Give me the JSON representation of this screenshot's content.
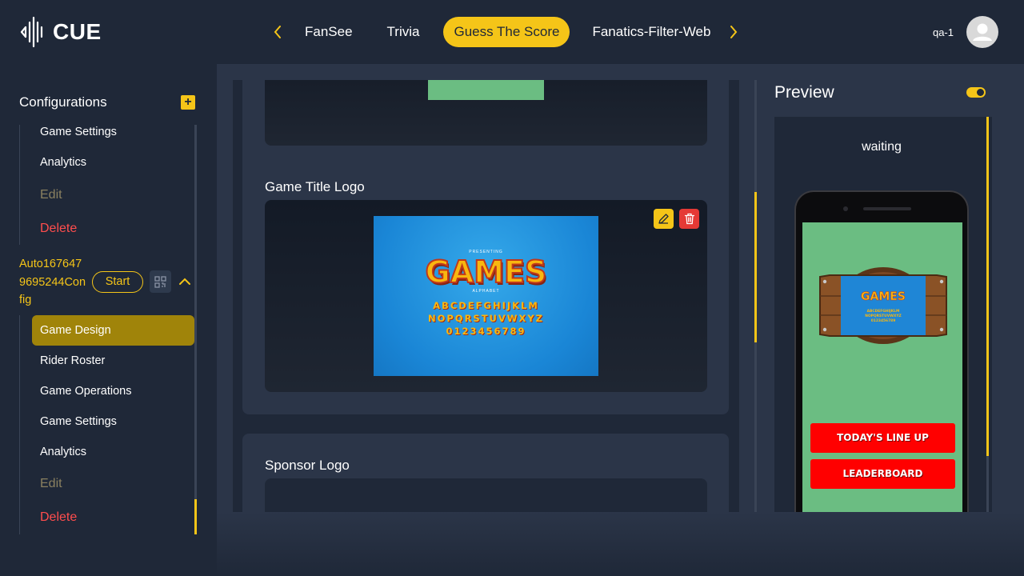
{
  "brand": {
    "name": "CUE"
  },
  "nav": {
    "tabs": [
      {
        "label": "FanSee"
      },
      {
        "label": "Trivia"
      },
      {
        "label": "Guess The Score"
      },
      {
        "label": "Fanatics-Filter-Web"
      }
    ],
    "active_tab": "Guess The Score"
  },
  "user": {
    "name": "qa-1"
  },
  "sidebar": {
    "heading": "Configurations",
    "group1": [
      {
        "label": "Game Settings"
      },
      {
        "label": "Analytics"
      },
      {
        "label": "Edit"
      },
      {
        "label": "Delete"
      }
    ],
    "config": {
      "name": "Auto1676479695244Config",
      "start_label": "Start"
    },
    "group2": [
      {
        "label": "Game Design"
      },
      {
        "label": "Rider Roster"
      },
      {
        "label": "Game Operations"
      },
      {
        "label": "Game Settings"
      },
      {
        "label": "Analytics"
      },
      {
        "label": "Edit"
      },
      {
        "label": "Delete"
      }
    ]
  },
  "main": {
    "game_title_logo_label": "Game Title Logo",
    "sponsor_logo_label": "Sponsor Logo",
    "logo_image": {
      "presenting": "PRESENTING",
      "title": "GAMES",
      "subtitle": "ALPHABET",
      "row1": "ABCDEFGHIJKLM",
      "row2": "NOPQRSTUVWXYZ",
      "row3": "0123456789"
    }
  },
  "preview": {
    "title": "Preview",
    "status": "waiting",
    "buttons": [
      {
        "label": "TODAY'S LINE UP"
      },
      {
        "label": "LEADERBOARD"
      }
    ]
  },
  "colors": {
    "accent": "#f5c518",
    "background": "#1f2838",
    "panel": "#2b3548",
    "danger": "#e53935",
    "preview_green": "#6bbd82"
  }
}
